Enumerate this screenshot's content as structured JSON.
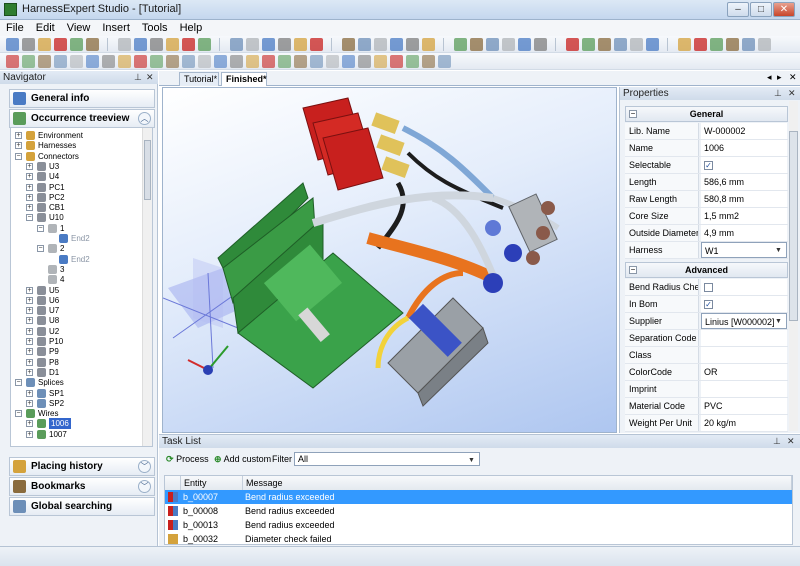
{
  "window": {
    "title": "HarnessExpert Studio - [Tutorial]",
    "min": "–",
    "max": "□",
    "close": "✕"
  },
  "menu": [
    "File",
    "Edit",
    "View",
    "Insert",
    "Tools",
    "Help"
  ],
  "navigator": {
    "title": "Navigator",
    "sections_top": [
      {
        "label": "General info"
      },
      {
        "label": "Occurrence treeview"
      }
    ],
    "tree": [
      {
        "label": "Environment",
        "level": 0,
        "exp": "+",
        "icon": "folder"
      },
      {
        "label": "Harnesses",
        "level": 0,
        "exp": "+",
        "icon": "folder"
      },
      {
        "label": "Connectors",
        "level": 0,
        "exp": "−",
        "icon": "folder"
      },
      {
        "label": "U3",
        "level": 1,
        "exp": "+",
        "icon": "conn"
      },
      {
        "label": "U4",
        "level": 1,
        "exp": "+",
        "icon": "conn"
      },
      {
        "label": "PC1",
        "level": 1,
        "exp": "+",
        "icon": "conn"
      },
      {
        "label": "PC2",
        "level": 1,
        "exp": "+",
        "icon": "conn"
      },
      {
        "label": "CB1",
        "level": 1,
        "exp": "+",
        "icon": "conn"
      },
      {
        "label": "U10",
        "level": 1,
        "exp": "−",
        "icon": "conn"
      },
      {
        "label": "1",
        "level": 2,
        "exp": "−",
        "icon": "pin"
      },
      {
        "label": "End2",
        "level": 3,
        "exp": "",
        "icon": "end",
        "dim": true
      },
      {
        "label": "2",
        "level": 2,
        "exp": "−",
        "icon": "pin"
      },
      {
        "label": "End2",
        "level": 3,
        "exp": "",
        "icon": "end",
        "dim": true
      },
      {
        "label": "3",
        "level": 2,
        "exp": "",
        "icon": "pin"
      },
      {
        "label": "4",
        "level": 2,
        "exp": "",
        "icon": "pin"
      },
      {
        "label": "U5",
        "level": 1,
        "exp": "+",
        "icon": "conn"
      },
      {
        "label": "U6",
        "level": 1,
        "exp": "+",
        "icon": "conn"
      },
      {
        "label": "U7",
        "level": 1,
        "exp": "+",
        "icon": "conn"
      },
      {
        "label": "U8",
        "level": 1,
        "exp": "+",
        "icon": "conn"
      },
      {
        "label": "U2",
        "level": 1,
        "exp": "+",
        "icon": "conn"
      },
      {
        "label": "P10",
        "level": 1,
        "exp": "+",
        "icon": "conn"
      },
      {
        "label": "P9",
        "level": 1,
        "exp": "+",
        "icon": "conn"
      },
      {
        "label": "P8",
        "level": 1,
        "exp": "+",
        "icon": "conn"
      },
      {
        "label": "D1",
        "level": 1,
        "exp": "+",
        "icon": "conn"
      },
      {
        "label": "Splices",
        "level": 0,
        "exp": "−",
        "icon": "splice"
      },
      {
        "label": "SP1",
        "level": 1,
        "exp": "+",
        "icon": "splice"
      },
      {
        "label": "SP2",
        "level": 1,
        "exp": "+",
        "icon": "splice"
      },
      {
        "label": "Wires",
        "level": 0,
        "exp": "−",
        "icon": "wire"
      },
      {
        "label": "1006",
        "level": 1,
        "exp": "+",
        "icon": "wire",
        "selected": true
      },
      {
        "label": "1007",
        "level": 1,
        "exp": "+",
        "icon": "wire"
      }
    ],
    "sections_bottom": [
      {
        "label": "Placing history"
      },
      {
        "label": "Bookmarks"
      },
      {
        "label": "Global searching"
      }
    ]
  },
  "tabs": [
    {
      "label": "Tutorial*"
    },
    {
      "label": "Finished*"
    }
  ],
  "properties": {
    "title": "Properties",
    "general_label": "General",
    "general": [
      {
        "key": "Lib. Name",
        "value": "W-000002",
        "kind": "text"
      },
      {
        "key": "Name",
        "value": "1006",
        "kind": "text"
      },
      {
        "key": "Selectable",
        "value": "✓",
        "kind": "check"
      },
      {
        "key": "Length",
        "value": "586,6 mm",
        "kind": "text"
      },
      {
        "key": "Raw Length",
        "value": "580,8 mm",
        "kind": "text"
      },
      {
        "key": "Core Size",
        "value": "1,5 mm2",
        "kind": "text"
      },
      {
        "key": "Outside Diameter",
        "value": "4,9 mm",
        "kind": "text"
      },
      {
        "key": "Harness",
        "value": "W1",
        "kind": "select"
      }
    ],
    "advanced_label": "Advanced",
    "advanced": [
      {
        "key": "Bend Radius Check",
        "value": "",
        "kind": "check"
      },
      {
        "key": "In Bom",
        "value": "✓",
        "kind": "check"
      },
      {
        "key": "Supplier",
        "value": "Linius [W000002]",
        "kind": "select"
      },
      {
        "key": "Separation Code",
        "value": "",
        "kind": "text"
      },
      {
        "key": "Class",
        "value": "",
        "kind": "text"
      },
      {
        "key": "ColorCode",
        "value": "OR",
        "kind": "text"
      },
      {
        "key": "Imprint",
        "value": "",
        "kind": "text"
      },
      {
        "key": "Material Code",
        "value": "PVC",
        "kind": "text"
      },
      {
        "key": "Weight Per Unit",
        "value": "20 kg/m",
        "kind": "text"
      }
    ]
  },
  "tasklist": {
    "title": "Task List",
    "process_label": "Process",
    "add_custom_label": "Add custom",
    "filter_label": "Filter",
    "filter_value": "All",
    "col_entity": "Entity",
    "col_message": "Message",
    "rows": [
      {
        "entity": "b_00007",
        "message": "Bend radius exceeded",
        "selected": true,
        "icon": "bend"
      },
      {
        "entity": "b_00008",
        "message": "Bend radius exceeded",
        "selected": false,
        "icon": "bend"
      },
      {
        "entity": "b_00013",
        "message": "Bend radius exceeded",
        "selected": false,
        "icon": "bend"
      },
      {
        "entity": "b_00032",
        "message": "Diameter check failed",
        "selected": false,
        "icon": "diameter"
      }
    ]
  },
  "colors": {
    "accent": "#3399ff",
    "wire_orange": "#e8731e",
    "board_green": "#2f8a3a",
    "connector_red": "#c8201e"
  }
}
